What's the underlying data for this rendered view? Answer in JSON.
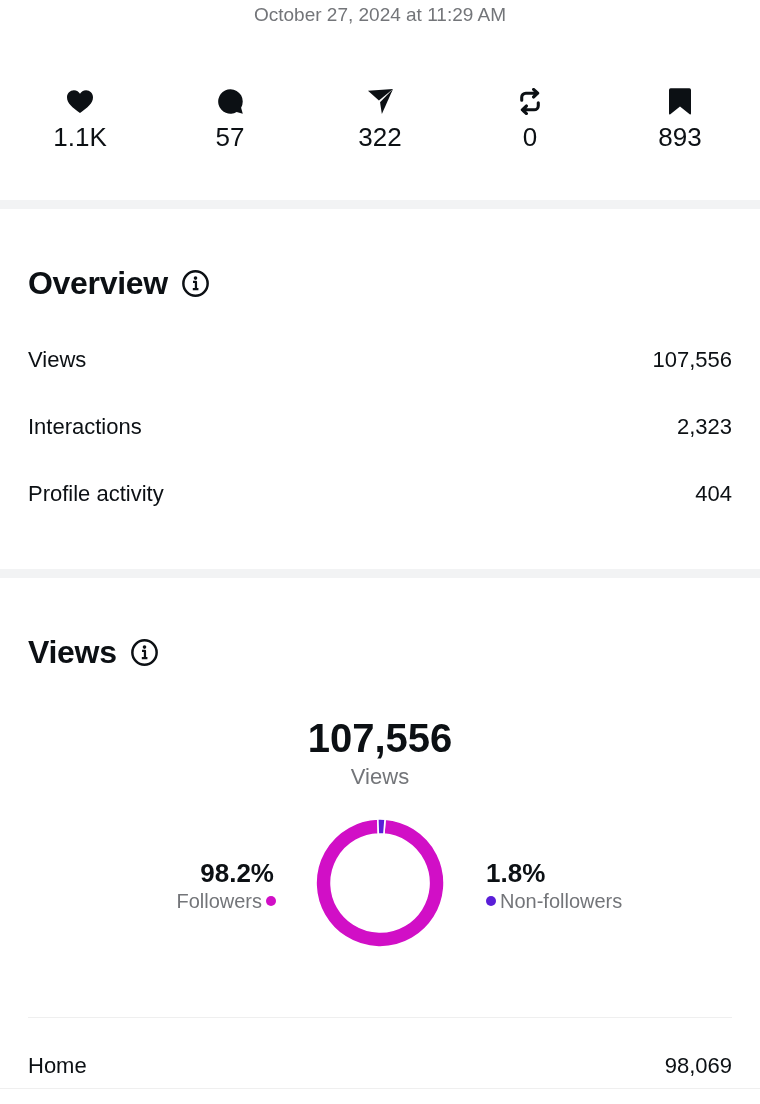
{
  "timestamp": "October 27, 2024 at 11:29 AM",
  "stats": [
    {
      "kind": "likes",
      "count": "1.1K"
    },
    {
      "kind": "comments",
      "count": "57"
    },
    {
      "kind": "shares",
      "count": "322"
    },
    {
      "kind": "reposts",
      "count": "0"
    },
    {
      "kind": "saves",
      "count": "893"
    }
  ],
  "overview": {
    "title": "Overview",
    "metrics": [
      {
        "label": "Views",
        "value": "107,556"
      },
      {
        "label": "Interactions",
        "value": "2,323"
      },
      {
        "label": "Profile activity",
        "value": "404"
      }
    ]
  },
  "views": {
    "title": "Views",
    "total": "107,556",
    "total_label": "Views",
    "legend": [
      {
        "percent": "98.2%",
        "color": "#d10fc6"
      },
      {
        "percent": "1.8%",
        "color": "#5a1ed8"
      }
    ],
    "chart_data": {
      "type": "donut",
      "categories": [
        "Followers",
        "Non-followers"
      ],
      "values": [
        98.2,
        1.8
      ]
    },
    "sources": [
      {
        "label": "Home",
        "value": "98,069"
      }
    ]
  }
}
